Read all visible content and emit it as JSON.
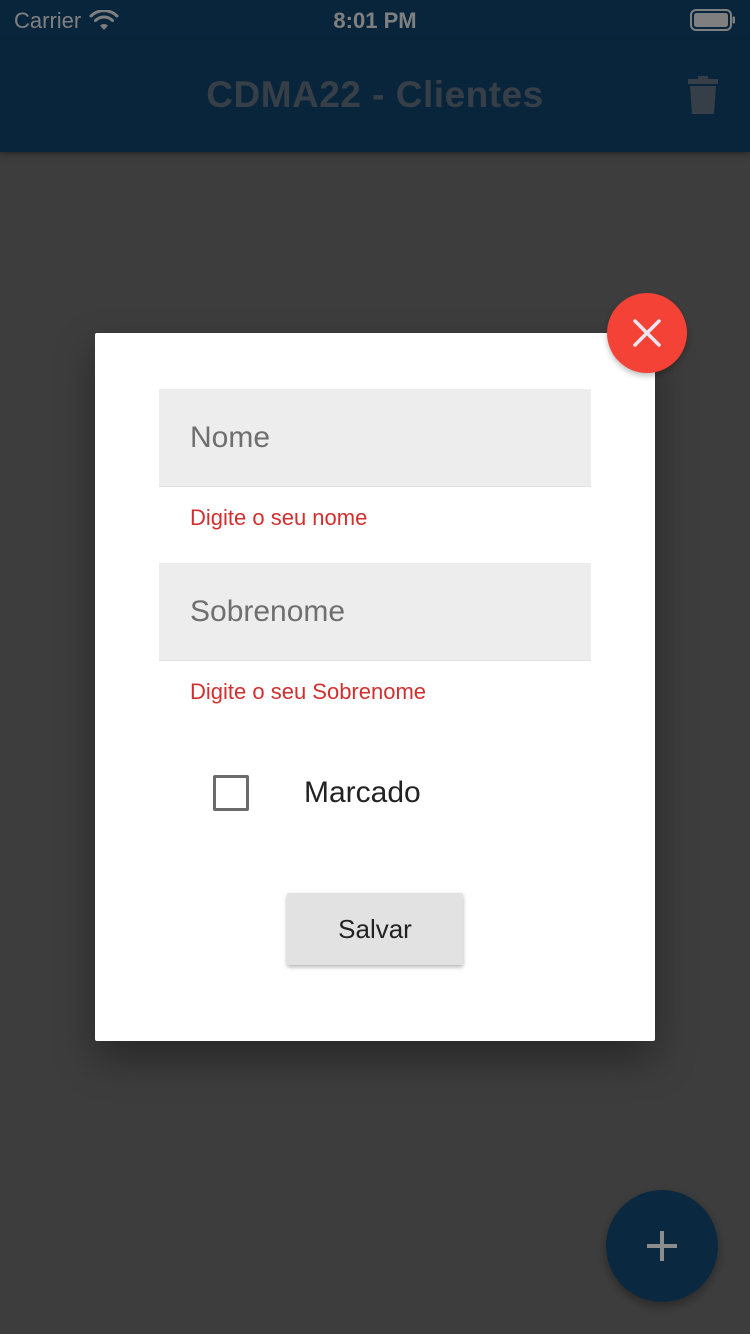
{
  "status_bar": {
    "carrier": "Carrier",
    "time": "8:01 PM"
  },
  "app_bar": {
    "title": "CDMA22 - Clientes",
    "action_icon": "trash-icon"
  },
  "dialog": {
    "close_icon": "close-icon",
    "name_field": {
      "placeholder": "Nome",
      "value": "",
      "error": "Digite o seu nome"
    },
    "surname_field": {
      "placeholder": "Sobrenome",
      "value": "",
      "error": "Digite o seu Sobrenome"
    },
    "checkbox": {
      "label": "Marcado",
      "checked": false
    },
    "save_label": "Salvar"
  },
  "fab": {
    "icon": "plus-icon"
  },
  "colors": {
    "primary": "#124a76",
    "close_button": "#f44336",
    "error_text": "#d32f2f",
    "field_fill": "#ededed"
  }
}
